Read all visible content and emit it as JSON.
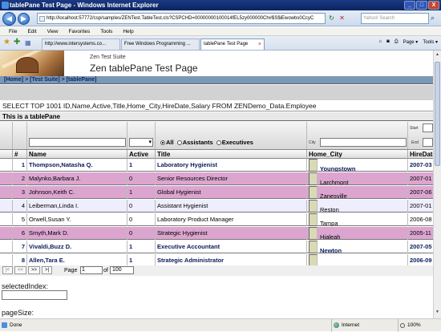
{
  "window": {
    "title": "tablePane Test Page - Windows Internet Explorer",
    "min": "_",
    "max": "□",
    "close": "X"
  },
  "nav": {
    "url": "http://localhost:57772/csp/samples/ZENTest.TableTest.cls?CSPCHD=0000000010001​4fEL5zy000000Ch#$S$iEwowbs0CcyC",
    "search_placeholder": "Yahoo! Search",
    "back_label": "◀",
    "forward_label": "▶",
    "refresh_label": "↻",
    "stop_label": "✕",
    "search_icon": "⌕"
  },
  "menu": [
    "File",
    "Edit",
    "View",
    "Favorites",
    "Tools",
    "Help"
  ],
  "tabs": [
    {
      "label": "http://www.intersystems.co...",
      "active": false
    },
    {
      "label": "Free Windows Programming ...",
      "active": false
    },
    {
      "label": "tablePane Test Page",
      "active": true
    }
  ],
  "toolbar_tools": {
    "home": "⌂",
    "feeds": "◙",
    "print": "⎙",
    "page": "Page ▾",
    "tools": "Tools ▾"
  },
  "page": {
    "suite": "Zen Test Suite",
    "title": "Zen tablePane Test Page",
    "breadcrumbs": [
      "[Home]",
      "[Test Suite]",
      "[tablePane]"
    ],
    "crumb_sep": " > ",
    "sql": "SELECT TOP 1001 ID,Name,Active,Title,Home_City,HireDate,Salary FROM ZENDemo_Data.Employee",
    "caption": "This is a tablePane",
    "filters": {
      "radio_options": [
        "All",
        "Assistants",
        "Executives"
      ],
      "radio_selected": "All",
      "city_label": "City",
      "start_label": "Start",
      "end_label": "End"
    },
    "columns": [
      "",
      "#",
      "Name",
      "Active",
      "Title",
      "Home_City",
      "HireDate"
    ],
    "rows": [
      {
        "num": "1",
        "name": "Thompson,Natasha Q.",
        "active": "1",
        "title": "Laboratory Hygienist",
        "city": "Youngstown",
        "hire": "2007-03",
        "style": "bold"
      },
      {
        "num": "2",
        "name": "Malynko,Barbara J.",
        "active": "0",
        "title": "Senior Resources Director",
        "city": "Larchmont",
        "hire": "2007-01",
        "style": "even"
      },
      {
        "num": "3",
        "name": "Johnson,Keith C.",
        "active": "1",
        "title": "Global Hygienist",
        "city": "Zanesville",
        "hire": "2007-06",
        "style": "even"
      },
      {
        "num": "4",
        "name": "Leiberman,Linda I.",
        "active": "0",
        "title": "Assistant Hygienist",
        "city": "Reston",
        "hire": "2007-01",
        "style": "sel1"
      },
      {
        "num": "5",
        "name": "Orwell,Susan Y.",
        "active": "0",
        "title": "Laboratory Product Manager",
        "city": "Tampa",
        "hire": "2006-08",
        "style": "odd"
      },
      {
        "num": "6",
        "name": "Smyth,Mark D.",
        "active": "0",
        "title": "Strategic Hygienist",
        "city": "Hialeah",
        "hire": "2005-11",
        "style": "even"
      },
      {
        "num": "7",
        "name": "Vivaldi,Buzz D.",
        "active": "1",
        "title": "Executive Accountant",
        "city": "Newton",
        "hire": "2007-05",
        "style": "bold"
      },
      {
        "num": "8",
        "name": "Allen,Tara E.",
        "active": "1",
        "title": "Strategic Administrator",
        "city": "",
        "hire": "2006-09",
        "style": "bold"
      }
    ],
    "pager": {
      "first": "|<",
      "prev": "<<",
      "next": ">>",
      "last": ">|",
      "page_label": "Page",
      "page_value": "1",
      "of_label": "of",
      "of_value": "100"
    },
    "selected_index_label": "selectedIndex:",
    "page_size_label": "pageSize:"
  },
  "status": {
    "text": "Done",
    "zone": "Internet",
    "zoom": "100%"
  }
}
